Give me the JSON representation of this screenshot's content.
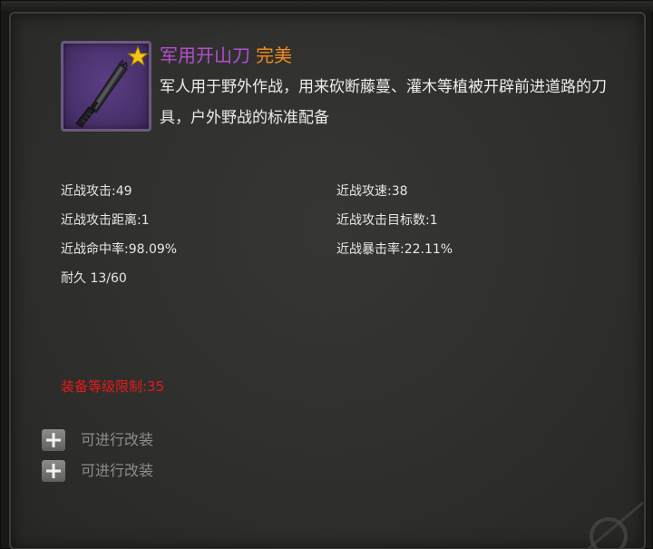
{
  "item": {
    "name": "军用开山刀",
    "quality": "完美",
    "description": "军人用于野外作战，用来砍断藤蔓、灌木等植被开辟前进道路的刀具，户外野战的标准配备",
    "icon": "machete-icon",
    "badge_icon": "star-icon"
  },
  "stats": {
    "melee_attack": "近战攻击:49",
    "melee_speed": "近战攻速:38",
    "melee_range": "近战攻击距离:1",
    "melee_targets": "近战攻击目标数:1",
    "melee_hit_rate": "近战命中率:98.09%",
    "melee_crit_rate": "近战暴击率:22.11%",
    "durability": "耐久 13/60"
  },
  "requirement": "装备等级限制:35",
  "modifications": [
    {
      "label": "可进行改装",
      "icon": "plus-icon"
    },
    {
      "label": "可进行改装",
      "icon": "plus-icon"
    }
  ],
  "colors": {
    "name": "#b34fd0",
    "quality": "#f08a1e",
    "requirement": "#e31b1b",
    "text": "#e6e6e6",
    "muted": "#8e8e8c",
    "icon_bg": "#47306a",
    "panel": "#32322f"
  }
}
